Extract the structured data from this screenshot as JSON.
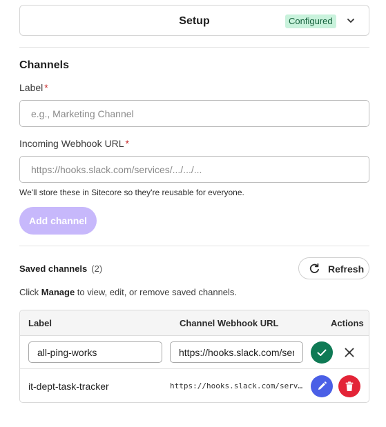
{
  "setup": {
    "title": "Setup",
    "status": "Configured"
  },
  "channels": {
    "title": "Channels",
    "label_field": {
      "label": "Label",
      "required_mark": "*",
      "placeholder": "e.g., Marketing Channel",
      "value": ""
    },
    "webhook_field": {
      "label": "Incoming Webhook URL",
      "required_mark": "*",
      "placeholder": "https://hooks.slack.com/services/.../.../...",
      "value": ""
    },
    "hint": "We'll store these in Sitecore so they're reusable for everyone.",
    "add_button": "Add channel"
  },
  "saved": {
    "title": "Saved channels",
    "count": "(2)",
    "refresh_button": "Refresh",
    "help_before": "Click ",
    "help_bold": "Manage",
    "help_after": " to view, edit, or remove saved channels."
  },
  "table": {
    "headers": {
      "label": "Label",
      "url": "Channel Webhook URL",
      "actions": "Actions"
    },
    "rows": [
      {
        "label": "all-ping-works",
        "url": "https://hooks.slack.com/services/",
        "editing": true
      },
      {
        "label": "it-dept-task-tracker",
        "url": "https://hooks.slack.com/services/",
        "editing": false
      }
    ]
  },
  "colors": {
    "accent_disabled": "#c7b8fb",
    "badge_bg": "#c9f2dc",
    "confirm": "#0f7a55",
    "edit": "#4a5fe6",
    "delete": "#e32437"
  },
  "icons": [
    "chevron-down-icon",
    "refresh-icon",
    "check-icon",
    "close-icon",
    "pencil-icon",
    "trash-icon"
  ]
}
